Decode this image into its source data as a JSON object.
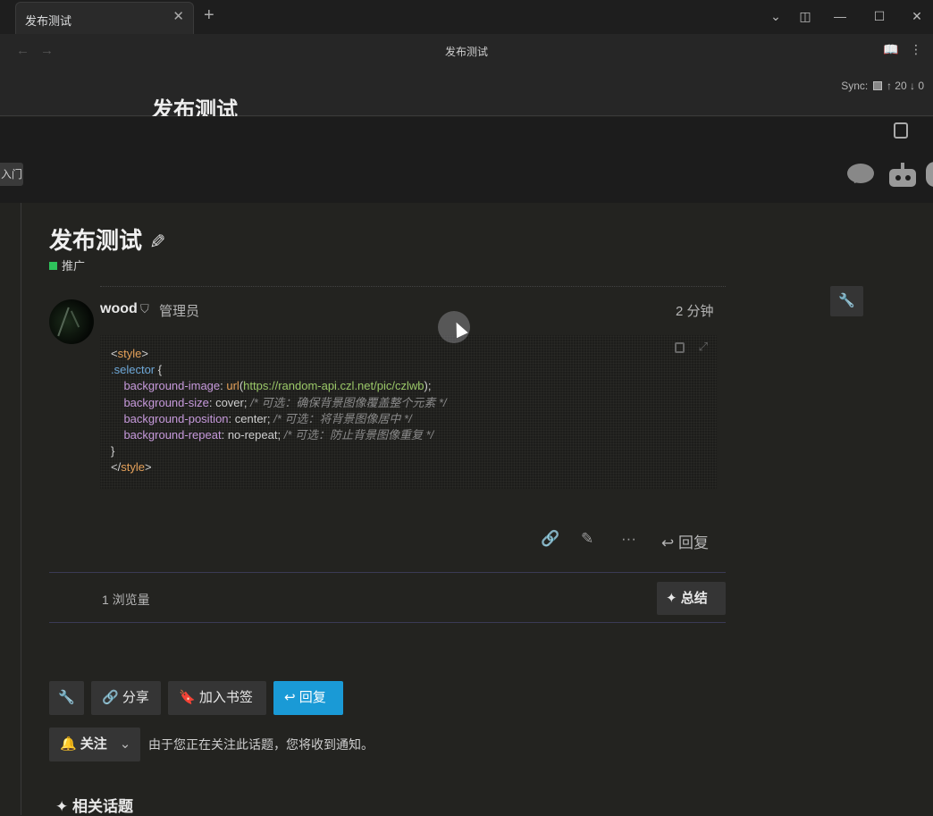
{
  "window": {
    "tab_title": "发布测试",
    "tab_close": "✕",
    "new_tab": "+",
    "nav_title": "发布测试",
    "sync_label": "Sync:",
    "sync_up": "↑ 20",
    "sync_down": "↓ 0",
    "band_left_label": "入门"
  },
  "topic": {
    "title": "发布测试",
    "category": "推广",
    "category_color": "#2ec25b"
  },
  "post": {
    "username": "wood",
    "role": "管理员",
    "time": "2 分钟",
    "code": {
      "l1_open": "<",
      "l1_tag": "style",
      "l1_close": ">",
      "l2_sel": ".selector",
      "l2_brace": " {",
      "l3_prop": "background-image",
      "l3_colon": ": ",
      "l3_fn": "url",
      "l3_paren_open": "(",
      "l3_url": "https://random-api.czl.net/pic/czlwb",
      "l3_end": ");",
      "l4_prop": "background-size",
      "l4_val": ": cover; ",
      "l4_comment": "/* 可选：确保背景图像覆盖整个元素 */",
      "l5_prop": "background-position",
      "l5_val": ": center; ",
      "l5_comment": "/* 可选：将背景图像居中 */",
      "l6_prop": "background-repeat",
      "l6_val": ": no-repeat; ",
      "l6_comment": "/* 可选：防止背景图像重复 */",
      "l7": "}",
      "l8_open": "</",
      "l8_tag": "style",
      "l8_close": ">"
    },
    "reply_label": "回复"
  },
  "stats": {
    "views": "1 浏览量",
    "summary_label": "总结"
  },
  "footer_buttons": {
    "share": "分享",
    "bookmark": "加入书签",
    "reply": "回复"
  },
  "notifications": {
    "level": "关注",
    "description": "由于您正在关注此话题，您将收到通知。"
  },
  "related": {
    "title": "相关话题"
  }
}
